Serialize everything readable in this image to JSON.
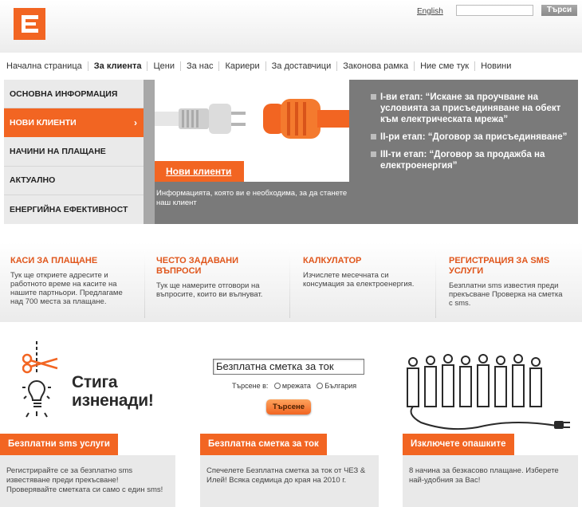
{
  "header": {
    "lang_link": "English",
    "search_value": "",
    "search_button": "Търси"
  },
  "nav": {
    "items": [
      "Начална страница",
      "За клиента",
      "Цени",
      "За нас",
      "Кариери",
      "За доставчици",
      "Законова рамка",
      "Ние сме тук",
      "Новини"
    ],
    "active": "За клиента"
  },
  "side_menu": {
    "items": [
      "ОСНОВНА ИНФОРМАЦИЯ",
      "НОВИ КЛИЕНТИ",
      "НАЧИНИ НА ПЛАЩАНЕ",
      "АКТУАЛНО",
      "ЕНЕРГИЙНА ЕФЕКТИВНОСТ"
    ],
    "active": "НОВИ КЛИЕНТИ",
    "chevron": "›"
  },
  "hero": {
    "button": "Нови клиенти",
    "caption": "Информацията, която ви е необходима, за да станете наш клиент"
  },
  "steps": [
    "I-ви етап: “Искане за проучване на условията за присъединяване на обект към електрическата мрежа”",
    "II-ри етап: “Договор за присъединяване”",
    "III-ти етап: “Договор за продажба на електроенергия”"
  ],
  "quick_links": [
    {
      "title": "КАСИ ЗА ПЛАЩАНЕ",
      "text": "Тук ще откриете адресите и работното време на касите на нашите партньори. Предлагаме над 700 места за плащане."
    },
    {
      "title": "ЧЕСТО ЗАДАВАНИ ВЪПРОСИ",
      "text": "Тук ще намерите отговори на въпросите, които ви вълнуват."
    },
    {
      "title": "КАЛКУЛАТОР",
      "text": "Изчислете месечната си консумация за електроенергия."
    },
    {
      "title": "РЕГИСТРАЦИЯ ЗА SMS УСЛУГИ",
      "text": "Безплатни sms известия преди прекъсване Проверка на сметка с sms."
    }
  ],
  "promos": {
    "sms": {
      "headline_1": "Стига",
      "headline_2": "изненади!",
      "tag": "Безплатни sms услуги",
      "text": "Регистрирайте се за безплатно sms известяване преди прекъсване! Проверявайте сметката си само с един sms!"
    },
    "bill": {
      "input_value": "Безплатна сметка за ток",
      "search_in": "Търсене в:",
      "option_1": "мрежата",
      "option_2": "България",
      "button": "Търсене",
      "tag": "Безплатна сметка за ток",
      "text": "Спечелете Безплатна сметка за ток от ЧЕЗ & Илей! Всяка седмица до края на 2010 г."
    },
    "queue": {
      "tag": "Изключете опашките",
      "text": "8 начина за безкасово плащане. Изберете най-удобния за Вас!"
    }
  },
  "colors": {
    "accent": "#f26522",
    "banner_gray": "#7a7a7a"
  }
}
